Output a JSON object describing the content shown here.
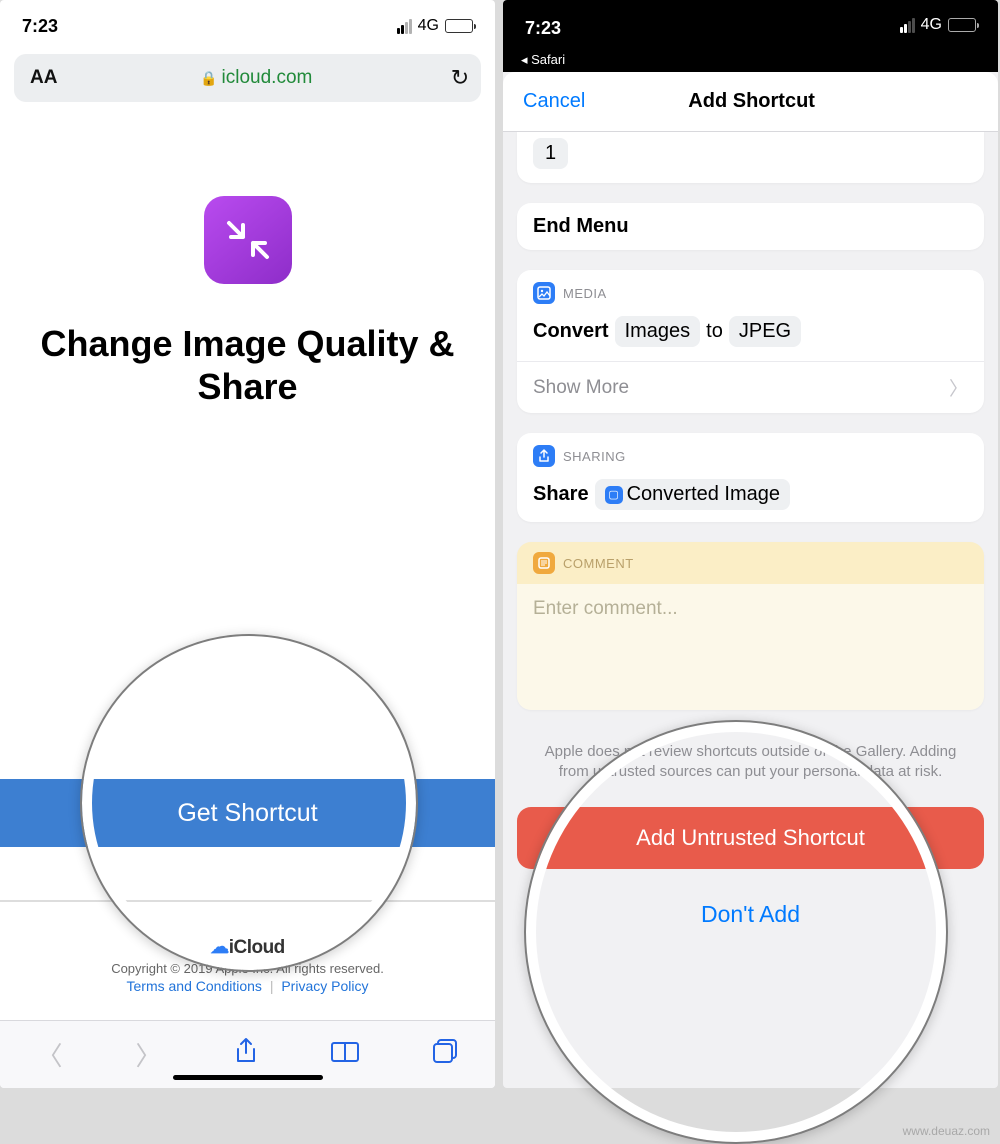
{
  "left": {
    "status": {
      "time": "7:23",
      "network": "4G"
    },
    "address_bar": {
      "aa": "AA",
      "url": "icloud.com"
    },
    "page_title": "Change Image Quality & Share",
    "get_button": "Get Shortcut",
    "footer": {
      "logo_text": "iCloud",
      "copyright": "Copyright © 2019 Apple Inc. All rights reserved.",
      "terms": "Terms and Conditions",
      "privacy": "Privacy Policy"
    }
  },
  "right": {
    "status": {
      "time": "7:23",
      "network": "4G",
      "back_app": "◂ Safari"
    },
    "sheet": {
      "cancel": "Cancel",
      "title": "Add Shortcut"
    },
    "blocks": {
      "badge": "1",
      "end_menu": "End Menu",
      "media": {
        "category": "MEDIA",
        "verb": "Convert",
        "input_token": "Images",
        "to": "to",
        "output_token": "JPEG",
        "show_more": "Show More"
      },
      "sharing": {
        "category": "SHARING",
        "verb": "Share",
        "token": "Converted Image"
      },
      "comment": {
        "category": "COMMENT",
        "placeholder": "Enter comment..."
      }
    },
    "warning": "Apple does not review shortcuts outside of the Gallery. Adding from untrusted sources can put your personal data at risk.",
    "add_button": "Add Untrusted Shortcut",
    "dont_add": "Don't Add"
  },
  "watermark": "www.deuaz.com"
}
